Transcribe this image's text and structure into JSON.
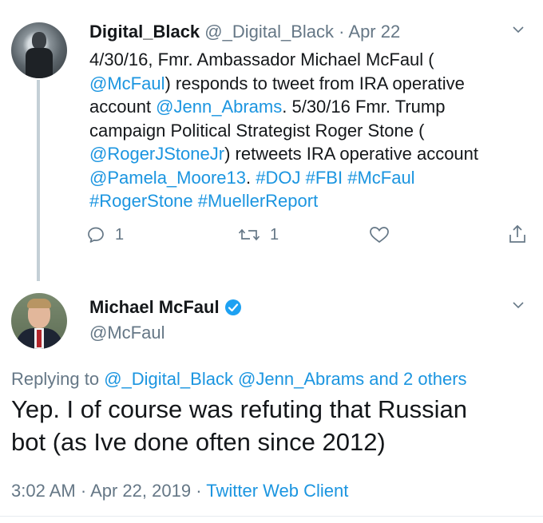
{
  "tweet1": {
    "display_name": "Digital_Black",
    "handle": "@_Digital_Black",
    "separator": "·",
    "date": "Apr 22",
    "text_segments": [
      {
        "t": "4/30/16, Fmr. Ambassador Michael McFaul (\n",
        "link": false
      },
      {
        "t": "@McFaul",
        "link": true
      },
      {
        "t": ") responds to tweet from IRA operative\naccount ",
        "link": false
      },
      {
        "t": "@Jenn_Abrams",
        "link": true
      },
      {
        "t": ". 5/30/16 Fmr. Trump\ncampaign Political Strategist Roger Stone (\n",
        "link": false
      },
      {
        "t": "@RogerJStoneJr",
        "link": true
      },
      {
        "t": ") retweets IRA operative account\n",
        "link": false
      },
      {
        "t": "@Pamela_Moore13",
        "link": true
      },
      {
        "t": ". ",
        "link": false
      },
      {
        "t": "#DOJ",
        "link": true
      },
      {
        "t": " ",
        "link": false
      },
      {
        "t": "#FBI",
        "link": true
      },
      {
        "t": " ",
        "link": false
      },
      {
        "t": "#McFaul",
        "link": true
      },
      {
        "t": "\n",
        "link": false
      },
      {
        "t": "#RogerStone",
        "link": true
      },
      {
        "t": " ",
        "link": false
      },
      {
        "t": "#MuellerReport",
        "link": true
      }
    ],
    "reply_count": "1",
    "retweet_count": "1"
  },
  "tweet2": {
    "display_name": "Michael McFaul",
    "handle": "@McFaul",
    "replying_prefix": "Replying to",
    "replying_to": "@_Digital_Black @Jenn_Abrams and 2 others",
    "text": "Yep. I of course was refuting that Russian\nbot (as Ive done often since 2012)",
    "time": "3:02 AM",
    "separator": "·",
    "date": "Apr 22, 2019",
    "source": "Twitter Web Client"
  },
  "colors": {
    "link": "#1b95e0",
    "secondary": "#657786",
    "verified": "#1da1f2",
    "thread_line": "#c4cfd6"
  },
  "icons": [
    "chevron-down-icon",
    "reply-icon",
    "retweet-icon",
    "like-icon",
    "share-icon",
    "verified-badge-icon"
  ]
}
